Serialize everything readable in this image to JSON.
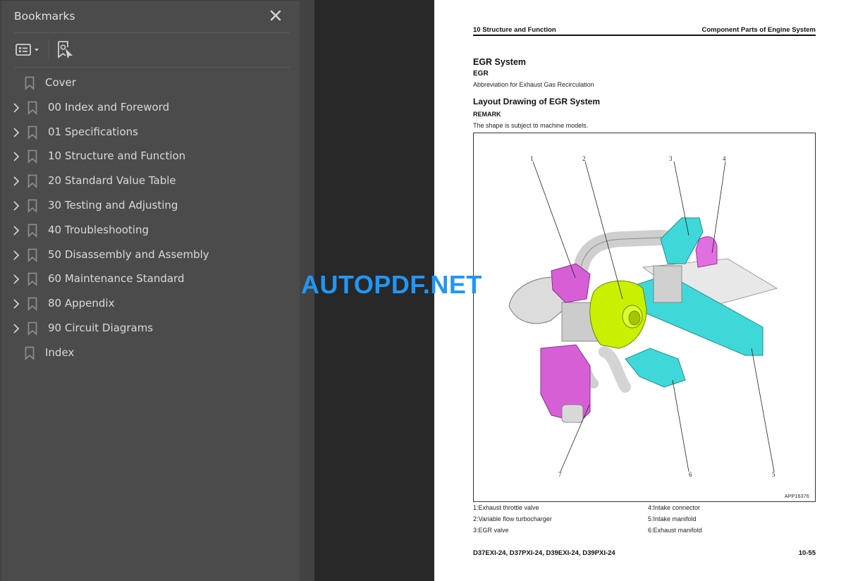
{
  "sidebar": {
    "title": "Bookmarks",
    "close_icon": "close-icon",
    "toolbar": {
      "options_icon": "bookmark-options-icon",
      "find_icon": "find-current-bookmark-icon"
    },
    "items": [
      {
        "label": "Cover",
        "expandable": false
      },
      {
        "label": "00 Index and Foreword",
        "expandable": true
      },
      {
        "label": "01 Specifications",
        "expandable": true
      },
      {
        "label": "10 Structure and Function",
        "expandable": true
      },
      {
        "label": "20 Standard Value Table",
        "expandable": true
      },
      {
        "label": "30 Testing and Adjusting",
        "expandable": true
      },
      {
        "label": "40 Troubleshooting",
        "expandable": true
      },
      {
        "label": "50 Disassembly and Assembly",
        "expandable": true
      },
      {
        "label": "60 Maintenance Standard",
        "expandable": true
      },
      {
        "label": "80 Appendix",
        "expandable": true
      },
      {
        "label": "90 Circuit Diagrams",
        "expandable": true
      },
      {
        "label": "Index",
        "expandable": false
      }
    ]
  },
  "watermark": "AUTOPDF.NET",
  "page": {
    "header_left": "10 Structure and Function",
    "header_right": "Component Parts of Engine System",
    "title": "EGR System",
    "term": "EGR",
    "term_definition": "Abbreviation for Exhaust Gas Recirculation",
    "section_title": "Layout Drawing of EGR System",
    "remark_label": "REMARK",
    "remark_text": "The shape is subject to machine models.",
    "figure": {
      "id": "APP16376",
      "callouts": [
        "1",
        "2",
        "3",
        "4",
        "5",
        "6",
        "7"
      ]
    },
    "legend": [
      "1:Exhaust throttle valve",
      "2:Variable flow turbocharger",
      "3:EGR valve",
      "4:Intake connector",
      "5:Intake manifold",
      "6:Exhaust manifold"
    ],
    "footer_models": "D37EXI-24, D37PXI-24, D39EXI-24, D39PXI-24",
    "page_number": "10-55"
  },
  "colors": {
    "watermark": "#2196f3",
    "part_magenta": "#d65fd6",
    "part_cyan": "#3fd8d8",
    "part_lime": "#c8f000",
    "part_grey": "#d8d8d8"
  }
}
